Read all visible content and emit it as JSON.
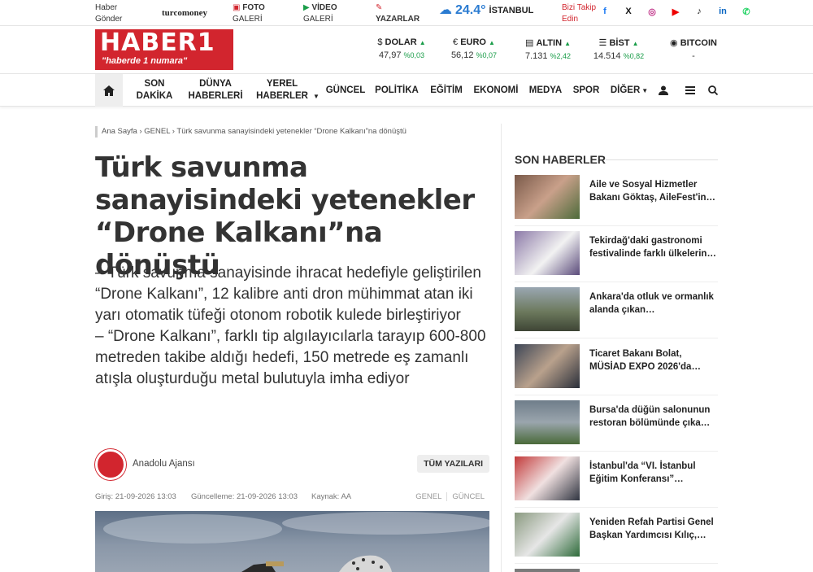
{
  "topbar": {
    "haber_gonder": "Haber\nGönder",
    "turcomoney": "turcomoney",
    "foto": "FOTO",
    "foto_sub": "GALERİ",
    "video": "VİDEO",
    "video_sub": "GALERİ",
    "yazarlar": "YAZARLAR",
    "temp": "24.4°",
    "city": "İSTANBUL",
    "follow": "Bizi Takip\nEdin",
    "social": [
      "f",
      "X",
      "◎",
      "▶",
      "♪",
      "in",
      "✆"
    ]
  },
  "header": {
    "logo_text": "HABER1",
    "logo_slogan": "\"haberde 1 numara\"",
    "markets": [
      {
        "name": "DOLAR",
        "icon": "$",
        "value": "47,97",
        "change": "%0,03"
      },
      {
        "name": "EURO",
        "icon": "€",
        "value": "56,12",
        "change": "%0,07"
      },
      {
        "name": "ALTIN",
        "icon": "▤",
        "value": "7.131",
        "change": "%2,42"
      },
      {
        "name": "BİST",
        "icon": "☰",
        "value": "14.514",
        "change": "%0,82"
      },
      {
        "name": "BITCOIN",
        "icon": "◉",
        "value": "-",
        "change": ""
      }
    ]
  },
  "nav": {
    "items": [
      "SON\nDAKİKA",
      "DÜNYA\nHABERLERİ",
      "YEREL\nHABERLER",
      "GÜNCEL",
      "POLİTİKA",
      "EĞİTİM",
      "EKONOMİ",
      "MEDYA",
      "SPOR",
      "DİĞER"
    ]
  },
  "article": {
    "breadcrumb": "Ana Sayfa › GENEL › Türk savunma sanayisindeki yetenekler “Drone Kalkanı”na dönüştü",
    "title": "Türk savunma sanayisindeki yetenekler “Drone Kalkanı”na dönüştü",
    "spot": "– Türk savunma sanayisinde ihracat hedefiyle geliştirilen “Drone Kalkanı”, 12 kalibre anti dron mühimmat atan iki yarı otomatik tüfeği otonom robotik kulede birleştiriyor\n– “Drone Kalkanı”, farklı tip algılayıcılarla tarayıp 600-800 metreden takibe aldığı hedefi, 150 metrede eş zamanlı atışla oluşturduğu metal bulutuyla imha ediyor",
    "author": "Anadolu Ajansı",
    "all_posts": "TÜM YAZILARI",
    "published": "Giriş: 21-09-2026 13:03",
    "updated": "Güncelleme: 21-09-2026 13:03",
    "source": "Kaynak: AA",
    "tags": [
      "GENEL",
      "GÜNCEL"
    ]
  },
  "sidebar": {
    "heading": "SON HABERLER",
    "news": [
      {
        "title": "Aile ve Sosyal Hizmetler Bakanı Göktaş, AileFest'in…",
        "color": "#7a5a4a"
      },
      {
        "title": "Tekirdağ'daki gastronomi festivalinde farklı ülkelerin…",
        "color": "#8c7aa8"
      },
      {
        "title": "Ankara'da otluk ve ormanlık alanda çıkan…",
        "color": "#6d7a5e"
      },
      {
        "title": "Ticaret Bakanı Bolat, MÜSİAD EXPO 2026'da…",
        "color": "#3d4656"
      },
      {
        "title": "Bursa'da düğün salonunun restoran bölümünde çıka…",
        "color": "#6f7d8a"
      },
      {
        "title": "İstanbul'da “VI. İstanbul Eğitim Konferansı”…",
        "color": "#c23a3a"
      },
      {
        "title": "Yeniden Refah Partisi Genel Başkan Yardımcısı Kılıç,…",
        "color": "#8a9a80"
      }
    ]
  }
}
